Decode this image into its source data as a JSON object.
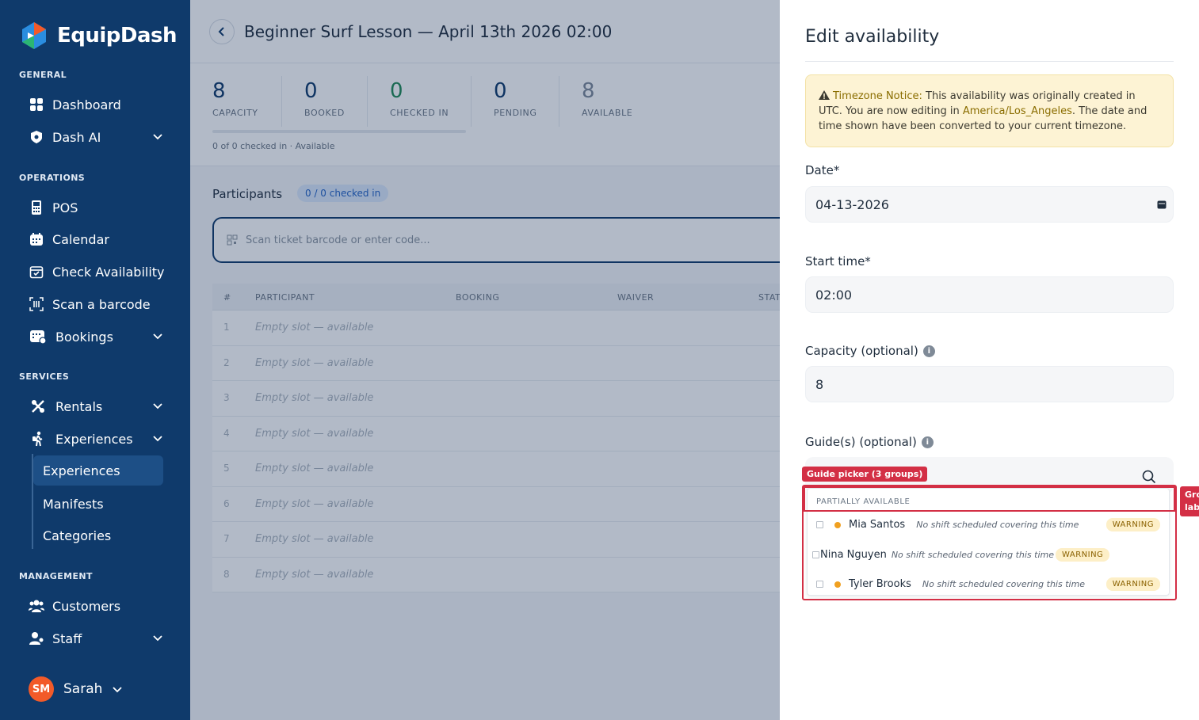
{
  "app": {
    "name": "EquipDash"
  },
  "sidebar": {
    "sections": {
      "general": "GENERAL",
      "operations": "OPERATIONS",
      "services": "SERVICES",
      "management": "MANAGEMENT"
    },
    "items": {
      "dashboard": "Dashboard",
      "dash_ai": "Dash AI",
      "pos": "POS",
      "calendar": "Calendar",
      "check_availability": "Check Availability",
      "scan_barcode": "Scan a barcode",
      "bookings": "Bookings",
      "rentals": "Rentals",
      "experiences": "Experiences",
      "customers": "Customers",
      "staff": "Staff"
    },
    "sub_items": [
      "Experiences",
      "Manifests",
      "Categories"
    ],
    "user": {
      "initials": "SM",
      "name": "Sarah"
    }
  },
  "main": {
    "title": "Beginner Surf Lesson — April 13th 2026 02:00",
    "stats": [
      {
        "value": "8",
        "label": "CAPACITY",
        "color": "#0f3a6b"
      },
      {
        "value": "0",
        "label": "BOOKED",
        "color": "#0f3a6b"
      },
      {
        "value": "0",
        "label": "CHECKED IN",
        "color": "#1f8a55"
      },
      {
        "value": "0",
        "label": "PENDING",
        "color": "#0f3a6b"
      },
      {
        "value": "8",
        "label": "AVAILABLE",
        "color": "#7c8898"
      }
    ],
    "progress": {
      "fraction": 0,
      "text": "0 of 0 checked in · Available"
    },
    "participants_title": "Participants",
    "participants_pill": "0 / 0 checked in",
    "scan_placeholder": "Scan ticket barcode or enter code...",
    "table": {
      "headers": [
        "#",
        "PARTICIPANT",
        "BOOKING",
        "WAIVER",
        "STAT"
      ],
      "rows": [
        {
          "idx": "1",
          "text": "Empty slot — available"
        },
        {
          "idx": "2",
          "text": "Empty slot — available"
        },
        {
          "idx": "3",
          "text": "Empty slot — available"
        },
        {
          "idx": "4",
          "text": "Empty slot — available"
        },
        {
          "idx": "5",
          "text": "Empty slot — available"
        },
        {
          "idx": "6",
          "text": "Empty slot — available"
        },
        {
          "idx": "7",
          "text": "Empty slot — available"
        },
        {
          "idx": "8",
          "text": "Empty slot — available"
        }
      ]
    }
  },
  "drawer": {
    "title": "Edit availability",
    "notice": {
      "lead": "Timezone Notice:",
      "part1": " This availability was originally created in UTC. You are now editing in ",
      "timezone": "America/Los_Angeles",
      "part2": ". The date and time shown have been converted to your current timezone."
    },
    "date": {
      "label": "Date*",
      "value": "04-13-2026"
    },
    "start_time": {
      "label": "Start time*",
      "value": "02:00"
    },
    "capacity": {
      "label": "Capacity (optional)",
      "value": "8"
    },
    "guides": {
      "label": "Guide(s) (optional)",
      "picker_tag": "Guide picker (3 groups)",
      "side_tag_line1": "Gro",
      "side_tag_line2": "lab",
      "group_label": "PARTIALLY AVAILABLE",
      "items": [
        {
          "name": "Mia Santos",
          "note": "No shift scheduled covering this time",
          "badge": "WARNING"
        },
        {
          "name": "Nina Nguyen",
          "note": "No shift scheduled covering this time",
          "badge": "WARNING"
        },
        {
          "name": "Tyler Brooks",
          "note": "No shift scheduled covering this time",
          "badge": "WARNING"
        }
      ]
    }
  }
}
